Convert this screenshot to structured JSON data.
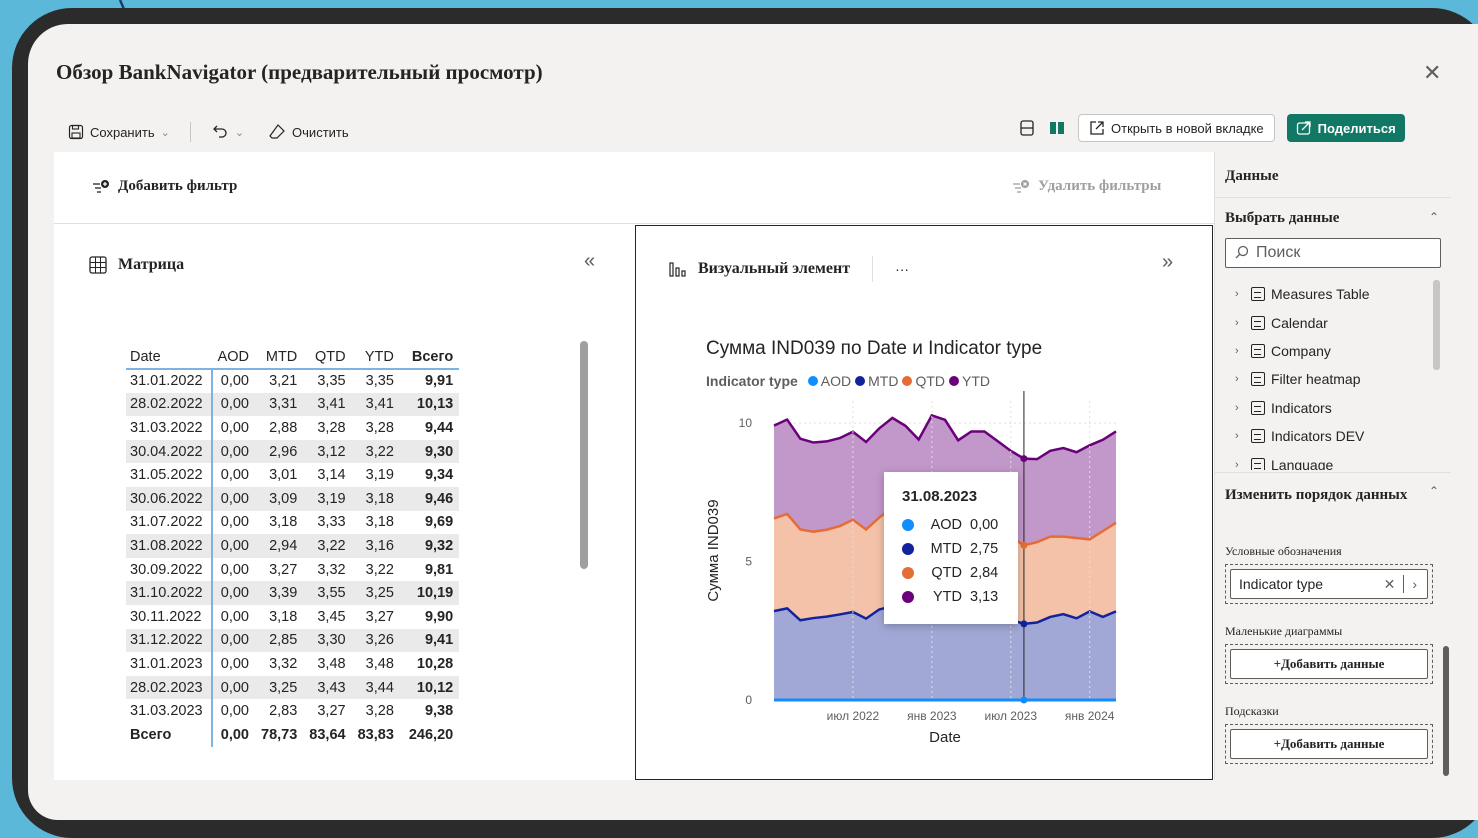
{
  "dialog": {
    "title": "Обзор BankNavigator (предварительный просмотр)",
    "close_glyph": "✕"
  },
  "toolbar": {
    "save_label": "Сохранить",
    "clear_label": "Очистить",
    "open_new_tab_label": "Открыть в новой вкладке",
    "share_label": "Поделиться"
  },
  "filters": {
    "add_label": "Добавить фильтр",
    "remove_label": "Удалить фильтры"
  },
  "matrix": {
    "title": "Матрица",
    "columns": [
      "Date",
      "AOD",
      "MTD",
      "QTD",
      "YTD",
      "Всего"
    ],
    "rows": [
      [
        "31.01.2022",
        "0,00",
        "3,21",
        "3,35",
        "3,35",
        "9,91"
      ],
      [
        "28.02.2022",
        "0,00",
        "3,31",
        "3,41",
        "3,41",
        "10,13"
      ],
      [
        "31.03.2022",
        "0,00",
        "2,88",
        "3,28",
        "3,28",
        "9,44"
      ],
      [
        "30.04.2022",
        "0,00",
        "2,96",
        "3,12",
        "3,22",
        "9,30"
      ],
      [
        "31.05.2022",
        "0,00",
        "3,01",
        "3,14",
        "3,19",
        "9,34"
      ],
      [
        "30.06.2022",
        "0,00",
        "3,09",
        "3,19",
        "3,18",
        "9,46"
      ],
      [
        "31.07.2022",
        "0,00",
        "3,18",
        "3,33",
        "3,18",
        "9,69"
      ],
      [
        "31.08.2022",
        "0,00",
        "2,94",
        "3,22",
        "3,16",
        "9,32"
      ],
      [
        "30.09.2022",
        "0,00",
        "3,27",
        "3,32",
        "3,22",
        "9,81"
      ],
      [
        "31.10.2022",
        "0,00",
        "3,39",
        "3,55",
        "3,25",
        "10,19"
      ],
      [
        "30.11.2022",
        "0,00",
        "3,18",
        "3,45",
        "3,27",
        "9,90"
      ],
      [
        "31.12.2022",
        "0,00",
        "2,85",
        "3,30",
        "3,26",
        "9,41"
      ],
      [
        "31.01.2023",
        "0,00",
        "3,32",
        "3,48",
        "3,48",
        "10,28"
      ],
      [
        "28.02.2023",
        "0,00",
        "3,25",
        "3,43",
        "3,44",
        "10,12"
      ],
      [
        "31.03.2023",
        "0,00",
        "2,83",
        "3,27",
        "3,28",
        "9,38"
      ]
    ],
    "total": [
      "Всего",
      "0,00",
      "78,73",
      "83,64",
      "83,83",
      "246,20"
    ]
  },
  "visual": {
    "title": "Визуальный элемент",
    "more": "···"
  },
  "chart_data": {
    "type": "area",
    "title": "Сумма IND039 по Date и Indicator type",
    "legend_title": "Indicator type",
    "legend_placement": "top-left",
    "xlabel": "Date",
    "ylabel": "Сумма IND039",
    "x_ticks": [
      "июл 2022",
      "янв 2023",
      "июл 2023",
      "янв 2024"
    ],
    "y_ticks": [
      "0",
      "5",
      "10"
    ],
    "ylim": [
      0,
      10.8
    ],
    "stacked": true,
    "x": [
      "2022-01-31",
      "2022-02-28",
      "2022-03-31",
      "2022-04-30",
      "2022-05-31",
      "2022-06-30",
      "2022-07-31",
      "2022-08-31",
      "2022-09-30",
      "2022-10-31",
      "2022-11-30",
      "2022-12-31",
      "2023-01-31",
      "2023-02-28",
      "2023-03-31",
      "2023-04-30",
      "2023-05-31",
      "2023-06-30",
      "2023-07-31",
      "2023-08-31",
      "2023-09-30",
      "2023-10-31",
      "2023-11-30",
      "2023-12-31",
      "2024-01-31",
      "2024-02-29",
      "2024-03-31"
    ],
    "series": [
      {
        "name": "AOD",
        "color": "#118dff",
        "values": [
          0,
          0,
          0,
          0,
          0,
          0,
          0,
          0,
          0,
          0,
          0,
          0,
          0,
          0,
          0,
          0,
          0,
          0,
          0,
          0,
          0,
          0,
          0,
          0,
          0,
          0,
          0
        ]
      },
      {
        "name": "MTD",
        "color": "#12239e",
        "values": [
          3.21,
          3.31,
          2.88,
          2.96,
          3.01,
          3.09,
          3.18,
          2.94,
          3.27,
          3.39,
          3.18,
          2.85,
          3.32,
          3.25,
          2.83,
          3.1,
          3.2,
          3.05,
          2.9,
          2.75,
          2.8,
          3.0,
          3.1,
          2.95,
          3.2,
          3.0,
          3.2
        ]
      },
      {
        "name": "QTD",
        "color": "#e66c37",
        "values": [
          3.35,
          3.41,
          3.28,
          3.12,
          3.14,
          3.19,
          3.33,
          3.22,
          3.32,
          3.55,
          3.45,
          3.3,
          3.48,
          3.43,
          3.27,
          3.3,
          3.2,
          3.1,
          3.0,
          2.84,
          2.9,
          2.9,
          2.8,
          2.9,
          2.6,
          3.1,
          3.2
        ]
      },
      {
        "name": "YTD",
        "color": "#6b007b",
        "values": [
          3.35,
          3.41,
          3.28,
          3.22,
          3.19,
          3.18,
          3.18,
          3.16,
          3.22,
          3.25,
          3.27,
          3.26,
          3.48,
          3.44,
          3.28,
          3.3,
          3.3,
          3.2,
          3.1,
          3.13,
          3.0,
          3.1,
          3.2,
          3.1,
          3.4,
          3.3,
          3.3
        ]
      }
    ]
  },
  "tooltip": {
    "date": "31.08.2023",
    "rows": [
      {
        "label": "AOD",
        "value": "0,00",
        "color": "#118dff"
      },
      {
        "label": "MTD",
        "value": "2,75",
        "color": "#12239e"
      },
      {
        "label": "QTD",
        "value": "2,84",
        "color": "#e66c37"
      },
      {
        "label": "YTD",
        "value": "3,13",
        "color": "#6b007b"
      }
    ]
  },
  "data_panel": {
    "header": "Данные",
    "select_data": "Выбрать данные",
    "search_placeholder": "Поиск",
    "tables": [
      "Measures Table",
      "Calendar",
      "Company",
      "Filter heatmap",
      "Indicators",
      "Indicators DEV",
      "Language"
    ],
    "reorder": "Изменить порядок данных",
    "legend_label": "Условные обозначения",
    "legend_value": "Indicator type",
    "small_multiples": "Маленькие диаграммы",
    "add_data": "+Добавить данные",
    "tooltips": "Подсказки"
  }
}
